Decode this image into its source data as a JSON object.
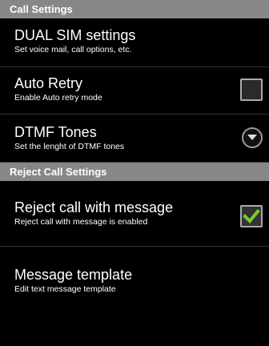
{
  "sections": [
    {
      "header": "Call Settings",
      "items": [
        {
          "title": "DUAL SIM settings",
          "summary": "Set voice mail, call options, etc.",
          "widget": "none"
        },
        {
          "title": "Auto Retry",
          "summary": "Enable Auto retry mode",
          "widget": "checkbox",
          "checked": false
        },
        {
          "title": "DTMF Tones",
          "summary": "Set the lenght of DTMF tones",
          "widget": "dropdown-icon"
        }
      ]
    },
    {
      "header": "Reject Call Settings",
      "items": [
        {
          "title": "Reject call with message",
          "summary": "Reject call with message is enabled",
          "widget": "checkbox",
          "checked": true
        },
        {
          "title": "Message template",
          "summary": "Edit text message template",
          "widget": "none"
        }
      ]
    }
  ],
  "colors": {
    "header_bg": "#878787",
    "check_mark": "#7acc2e",
    "background": "#000000"
  }
}
